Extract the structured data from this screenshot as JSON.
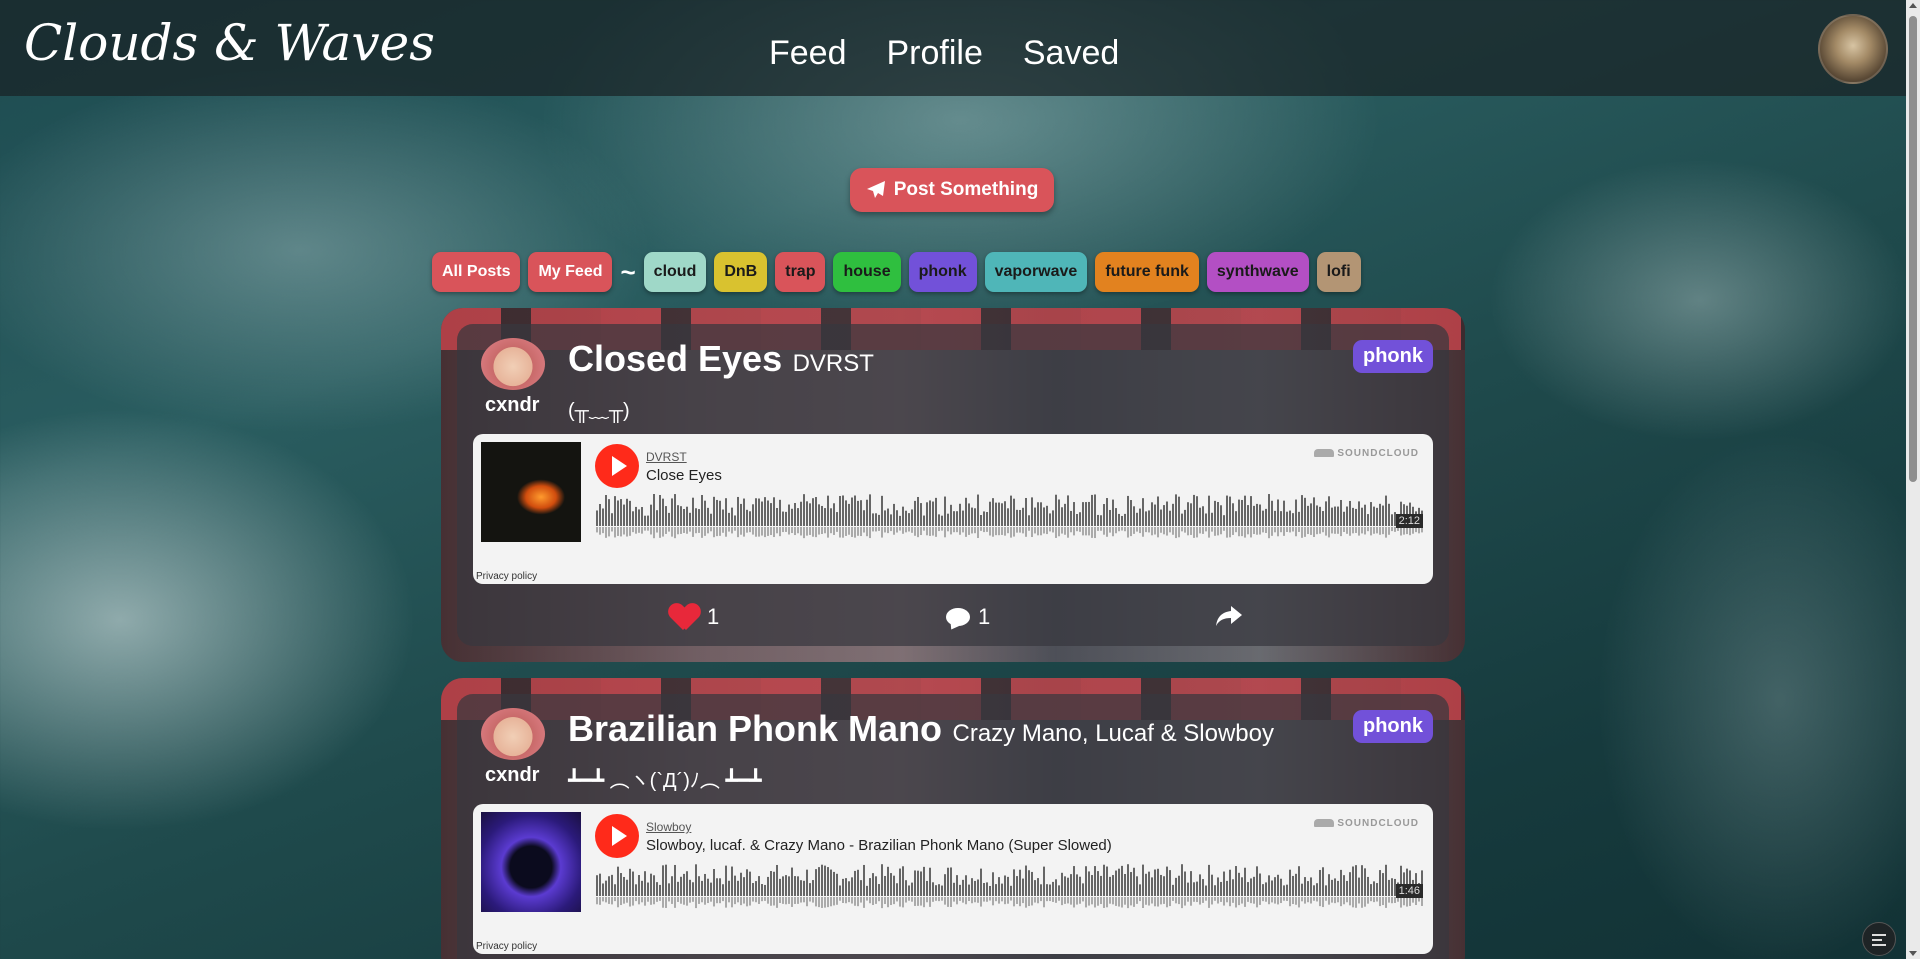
{
  "app": {
    "logo": "Clouds & Waves"
  },
  "nav": [
    {
      "label": "Feed"
    },
    {
      "label": "Profile"
    },
    {
      "label": "Saved"
    }
  ],
  "post_button": {
    "label": "Post Something",
    "icon": "paper-plane-icon"
  },
  "filters": {
    "all_posts": "All Posts",
    "my_feed": "My Feed",
    "separator": "~",
    "genres": [
      {
        "label": "cloud",
        "color": "#9fd8c8"
      },
      {
        "label": "DnB",
        "color": "#d9c22f"
      },
      {
        "label": "trap",
        "color": "#d9545a"
      },
      {
        "label": "house",
        "color": "#2fbf3f"
      },
      {
        "label": "phonk",
        "color": "#7251d9"
      },
      {
        "label": "vaporwave",
        "color": "#4fb6b8"
      },
      {
        "label": "future funk",
        "color": "#e2821f"
      },
      {
        "label": "synthwave",
        "color": "#b34fc4"
      },
      {
        "label": "lofi",
        "color": "#b39574"
      }
    ]
  },
  "posts": [
    {
      "username": "cxndr",
      "title": "Closed Eyes",
      "artist": "DVRST",
      "caption": "(╥﹏╥)",
      "genre": "phonk",
      "player": {
        "artist": "DVRST",
        "track": "Close Eyes",
        "duration": "2:12",
        "brand": "SOUNDCLOUD",
        "privacy": "Privacy policy"
      },
      "likes": "1",
      "comments": "1"
    },
    {
      "username": "cxndr",
      "title": "Brazilian Phonk Mano",
      "artist": "Crazy Mano, Lucaf & Slowboy",
      "caption": "┻━┻ ︵ヽ(`Д´)ﾉ︵ ┻━┻",
      "genre": "phonk",
      "player": {
        "artist": "Slowboy",
        "track": "Slowboy, lucaf. & Crazy Mano - Brazilian Phonk Mano (Super Slowed)",
        "duration": "1:46",
        "brand": "SOUNDCLOUD",
        "privacy": "Privacy policy"
      }
    }
  ]
}
